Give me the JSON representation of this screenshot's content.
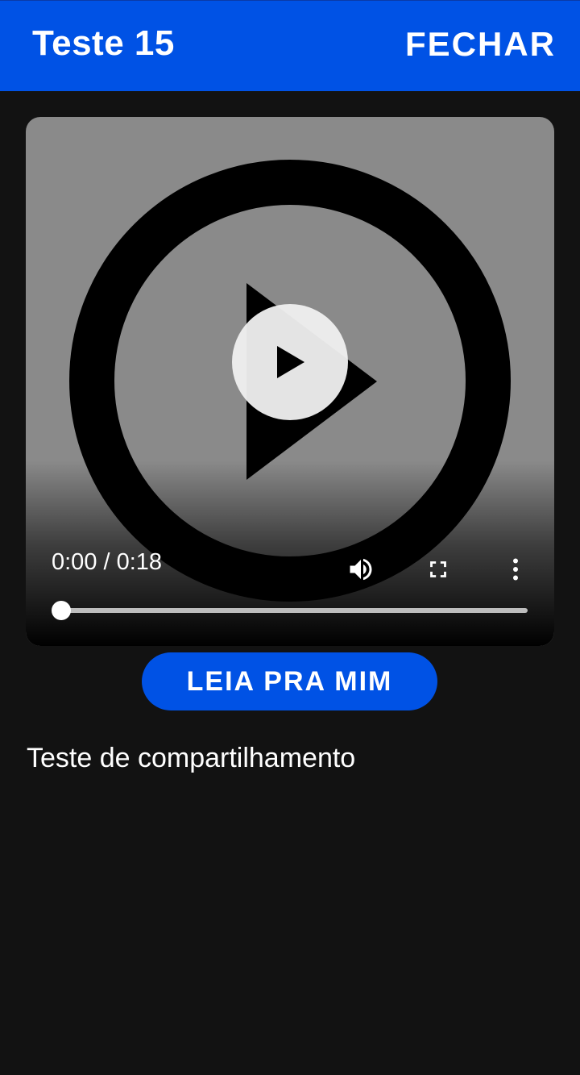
{
  "header": {
    "title": "Teste 15",
    "close_label": "FECHAR"
  },
  "video": {
    "thumbnail_icon": "play-circle-icon",
    "play_icon": "play-icon",
    "current_time": "0:00",
    "duration": "0:18",
    "time_display": "0:00 / 0:18",
    "progress": 0,
    "volume_icon": "volume-icon",
    "fullscreen_icon": "fullscreen-icon",
    "more_icon": "more-vert-icon"
  },
  "read_button": {
    "label": "LEIA PRA MIM"
  },
  "content": {
    "description": "Teste de compartilhamento"
  },
  "colors": {
    "accent": "#0052e5",
    "background": "#121212",
    "video_background": "#8a8a8a"
  }
}
